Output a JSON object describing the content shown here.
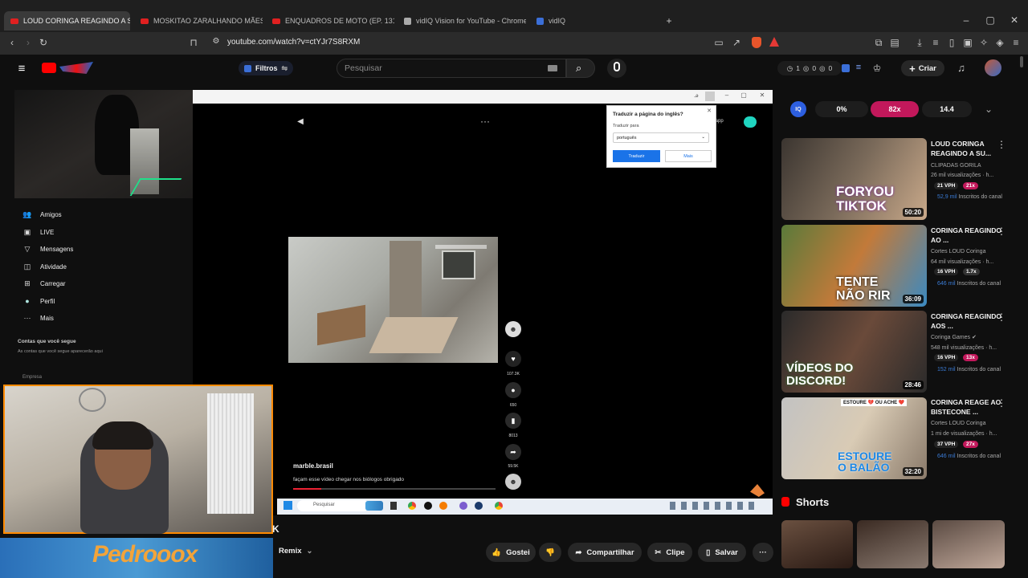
{
  "tabs": [
    {
      "label": "LOUD CORINGA REAGINDO A SU",
      "fav": "yt",
      "active": true
    },
    {
      "label": "MOSKITAO ZARALHANDO MÃES SO",
      "fav": "yt"
    },
    {
      "label": "ENQUADROS DE MOTO (EP. 131) - Y",
      "fav": "yt"
    },
    {
      "label": "vidIQ Vision for YouTube - Chrome W",
      "fav": "v"
    },
    {
      "label": "vidIQ",
      "fav": "iq"
    }
  ],
  "address": {
    "url": "youtube.com/watch?v=ctYJr7S8RXM"
  },
  "header": {
    "filters_label": "Filtros",
    "search_placeholder": "Pesquisar",
    "create_label": "Criar",
    "counts": [
      "1",
      "0",
      "0"
    ]
  },
  "sidebar": {
    "items": [
      {
        "label": "Amigos",
        "icon": "friends-icon",
        "glyph": "👥"
      },
      {
        "label": "LIVE",
        "icon": "live-icon",
        "glyph": "▣"
      },
      {
        "label": "Mensagens",
        "icon": "messages-icon",
        "glyph": "▽"
      },
      {
        "label": "Atividade",
        "icon": "activity-icon",
        "glyph": "◫"
      },
      {
        "label": "Carregar",
        "icon": "upload-icon",
        "glyph": "⊞"
      },
      {
        "label": "Perfil",
        "icon": "profile-icon",
        "glyph": "●"
      },
      {
        "label": "Mais",
        "icon": "more-icon",
        "glyph": "···"
      }
    ],
    "following_title": "Contas que você segue",
    "following_sub": "As contas que você segue aparecerão aqui",
    "empresa": "Empresa"
  },
  "video": {
    "username": "marble.brasil",
    "caption": "façam esse vídeo chegar nos biólogos obrigado",
    "likes": "107.3K",
    "comments": "650",
    "saves": "8013",
    "shares": "59.5K",
    "app_label": "r app",
    "taskbar_search": "Pesquisar",
    "popup": {
      "title": "Traduzir a página do inglês?",
      "label": "Traduzir para",
      "lang": "português",
      "translate": "Traduzir",
      "more": "Mais"
    }
  },
  "actions": {
    "remix": "Remix",
    "like": "Gostei",
    "share": "Compartilhar",
    "clip": "Clipe",
    "save": "Salvar",
    "title_fragment": "K"
  },
  "vidiq": {
    "percent": "0%",
    "multiplier": "82x",
    "score": "14.4"
  },
  "related": [
    {
      "title": "LOUD CORINGA REAGINDO A SU...",
      "channel": "CLIPADAS GORILA",
      "views": "26 mil visualizações · h...",
      "vph": "21 VPH",
      "mult": "21x",
      "subs_val": "52,9 mil",
      "subs_label": "Inscritos do canal",
      "duration": "50:20",
      "thumb_text": "FORYOU TIKTOK"
    },
    {
      "title": "CORINGA REAGINDO AO ...",
      "channel": "Cortes LOUD Coringa",
      "views": "64 mil visualizações · h...",
      "vph": "16 VPH",
      "mult": "1.7x",
      "subs_val": "646 mil",
      "subs_label": "Inscritos do canal",
      "duration": "36:09",
      "thumb_text": "TENTE NÃO RIR"
    },
    {
      "title": "CORINGA REAGINDO AOS ...",
      "channel": "Coringa Games",
      "views": "548 mil visualizações · h...",
      "vph": "16 VPH",
      "mult": "13x",
      "subs_val": "152 mil",
      "subs_label": "Inscritos do canal",
      "duration": "28:46",
      "thumb_text": "VÍDEOS DO DISCORD!"
    },
    {
      "title": "CORINGA REAGE AO BISTECONE ...",
      "channel": "Cortes LOUD Coringa",
      "views": "1 mi de visualizações · h...",
      "vph": "37 VPH",
      "mult": "27x",
      "subs_val": "646 mil",
      "subs_label": "Inscritos do canal",
      "duration": "32:20",
      "thumb_text": "ESTOURE O BALÃO",
      "badge": "ESTOURE 💔 OU ACHE ❤️"
    }
  ],
  "shorts_label": "Shorts",
  "banner_text": "Pedrooox",
  "colors": {
    "accent": "#ff0000",
    "vidiq_pink": "#c2185b",
    "webcam_border": "#ff8a00"
  }
}
